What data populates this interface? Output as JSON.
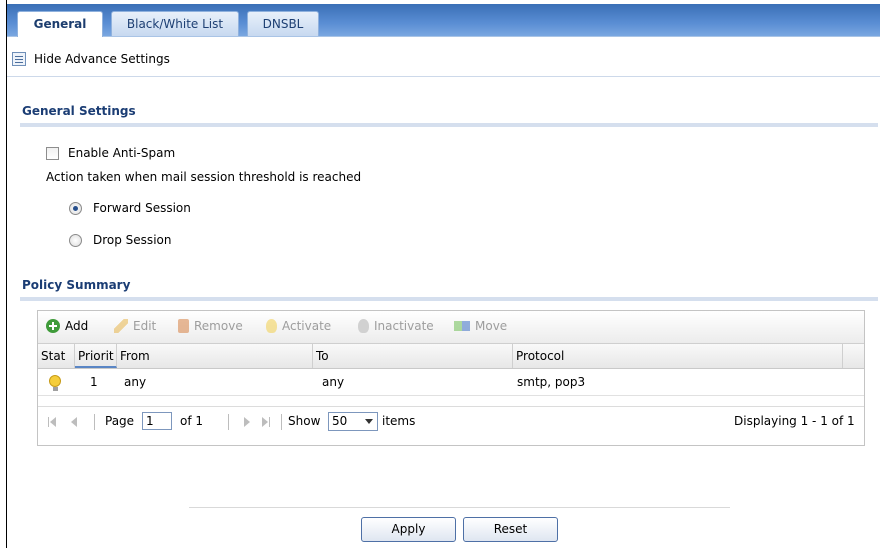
{
  "tabs": [
    {
      "label": "General",
      "active": true
    },
    {
      "label": "Black/White List",
      "active": false
    },
    {
      "label": "DNSBL",
      "active": false
    }
  ],
  "advanced_link": "Hide Advance Settings",
  "general_settings": {
    "title": "General Settings",
    "enable_label": "Enable Anti-Spam",
    "enable_checked": false,
    "threshold_label": "Action taken when mail session threshold is reached",
    "options": [
      {
        "label": "Forward Session",
        "selected": true
      },
      {
        "label": "Drop Session",
        "selected": false
      }
    ]
  },
  "policy_summary": {
    "title": "Policy Summary",
    "toolbar": {
      "add": "Add",
      "edit": "Edit",
      "remove": "Remove",
      "activate": "Activate",
      "inactivate": "Inactivate",
      "move": "Move"
    },
    "columns": [
      "Stat",
      "Priorit",
      "From",
      "To",
      "Protocol"
    ],
    "rows": [
      {
        "status": "active",
        "priority": "1",
        "from": "any",
        "to": "any",
        "protocol": "smtp, pop3"
      }
    ],
    "pager": {
      "page_label": "Page",
      "page_value": "1",
      "of_label": "of 1",
      "show_label": "Show",
      "show_value": "50",
      "items_label": "items",
      "displaying": "Displaying 1 - 1 of 1"
    }
  },
  "buttons": {
    "apply": "Apply",
    "reset": "Reset"
  },
  "colors": {
    "tab_bar": "#4a7fc9",
    "section_title": "#1b3d74",
    "active_bulb": "#f5cd3a"
  }
}
